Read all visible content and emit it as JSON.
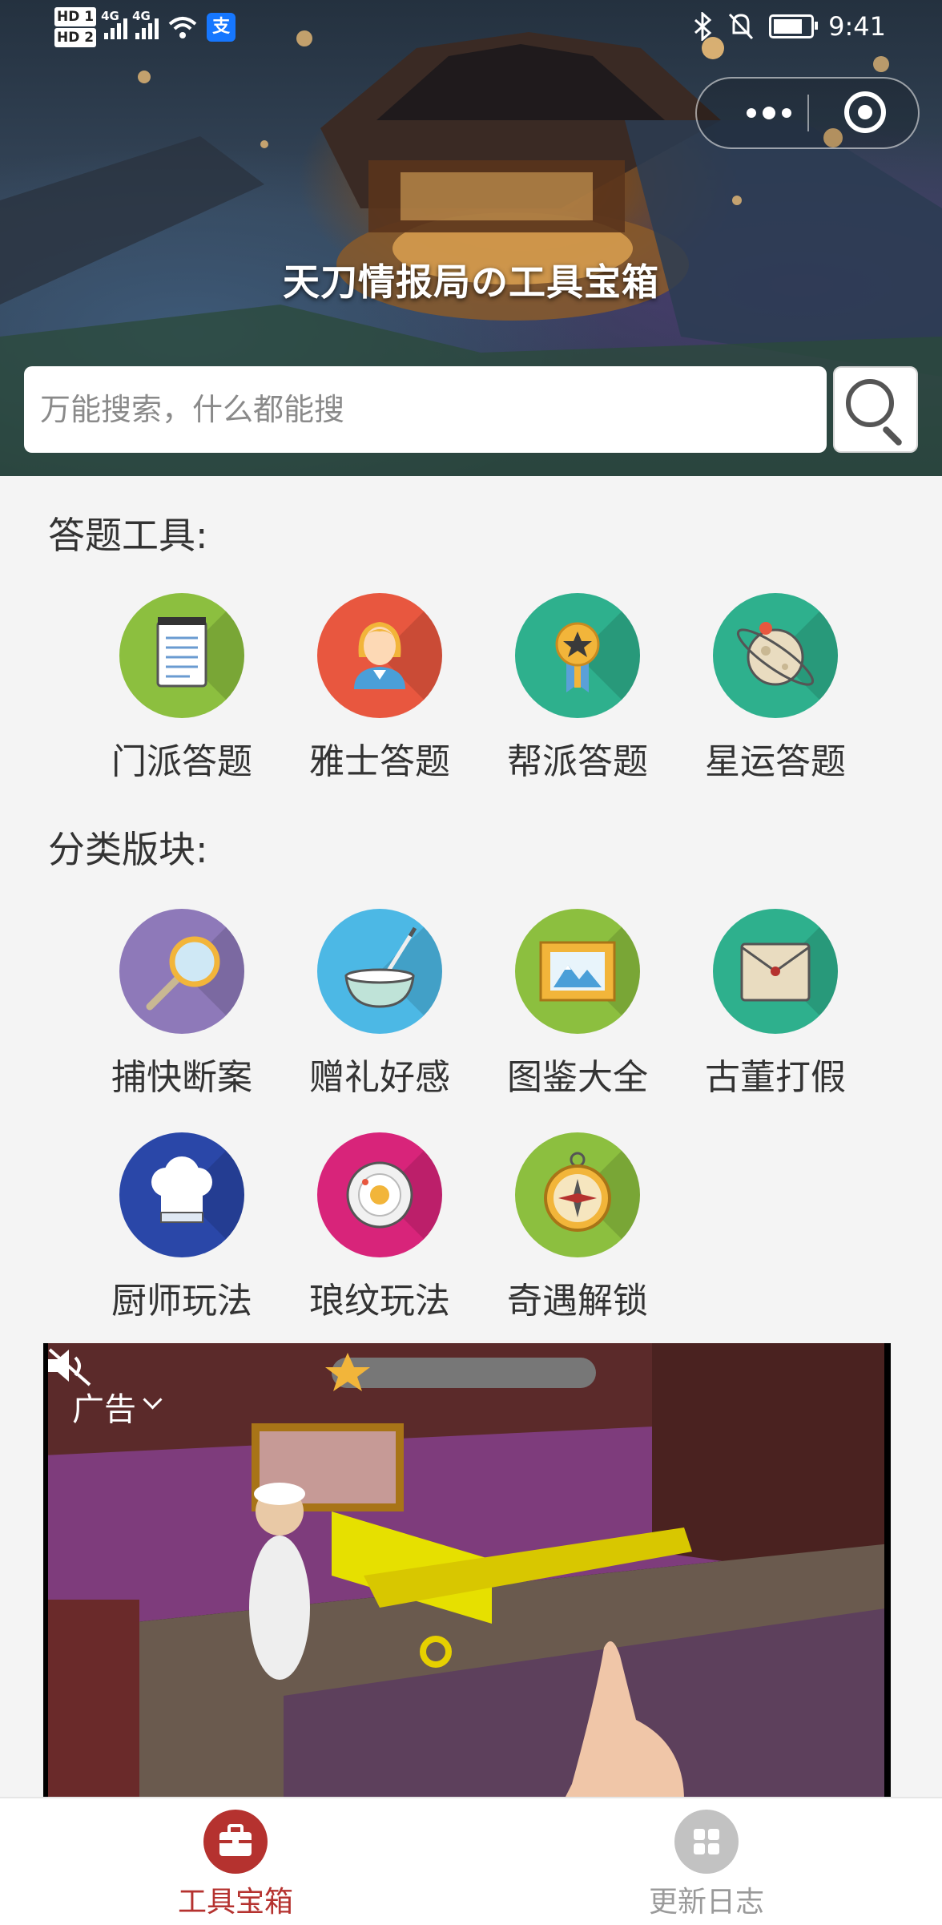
{
  "status_bar": {
    "hd1": "HD 1",
    "hd2": "HD 2",
    "net1": "4G",
    "net2": "4G",
    "alipay_icon": "支",
    "time": "9:41"
  },
  "header": {
    "title": "天刀情报局の工具宝箱",
    "search_placeholder": "万能搜索，什么都能搜"
  },
  "sections": [
    {
      "title": "答题工具:",
      "items": [
        {
          "label": "门派答题",
          "icon": "notepad-icon",
          "color": "#8cbf3f"
        },
        {
          "label": "雅士答题",
          "icon": "lady-avatar-icon",
          "color": "#e8573f"
        },
        {
          "label": "帮派答题",
          "icon": "medal-icon",
          "color": "#2eb08d"
        },
        {
          "label": "星运答题",
          "icon": "planet-icon",
          "color": "#2eb08d"
        }
      ]
    },
    {
      "title": "分类版块:",
      "items": [
        {
          "label": "捕快断案",
          "icon": "magnifier-icon",
          "color": "#8e79b9"
        },
        {
          "label": "赠礼好感",
          "icon": "bowl-icon",
          "color": "#4cb8e5"
        },
        {
          "label": "图鉴大全",
          "icon": "picture-frame-icon",
          "color": "#8cbf3f"
        },
        {
          "label": "古董打假",
          "icon": "envelope-icon",
          "color": "#2eb08d"
        },
        {
          "label": "厨师玩法",
          "icon": "chef-hat-icon",
          "color": "#2a47a8"
        },
        {
          "label": "琅纹玩法",
          "icon": "plate-icon",
          "color": "#d8247a"
        },
        {
          "label": "奇遇解锁",
          "icon": "compass-icon",
          "color": "#8cbf3f"
        }
      ]
    }
  ],
  "ad": {
    "label": "广告"
  },
  "tabbar": {
    "tabs": [
      {
        "label": "工具宝箱",
        "icon": "toolbox-icon",
        "active": true
      },
      {
        "label": "更新日志",
        "icon": "grid-icon",
        "active": false
      }
    ],
    "active_color": "#b5322f",
    "inactive_color": "#9a9a9a"
  }
}
